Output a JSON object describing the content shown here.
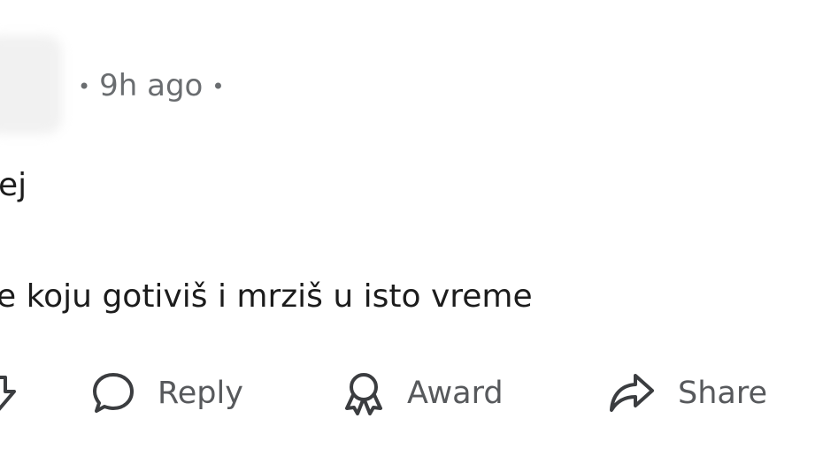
{
  "comment": {
    "timestamp": "9h ago",
    "separator": "•",
    "title_fragment": "ej",
    "body_fragment": "e koju gotiviš i mrziš u isto vreme"
  },
  "actions": {
    "vote_icon": "downvote-arrow-icon",
    "reply_icon": "speech-bubble-icon",
    "reply_label": "Reply",
    "award_icon": "award-medal-icon",
    "award_label": "Award",
    "share_icon": "share-arrow-icon",
    "share_label": "Share"
  },
  "colors": {
    "text": "#1c1c1c",
    "meta": "#6a6d70",
    "action_text": "#57595c",
    "icon_stroke": "#3b3d40",
    "background": "#ffffff"
  }
}
